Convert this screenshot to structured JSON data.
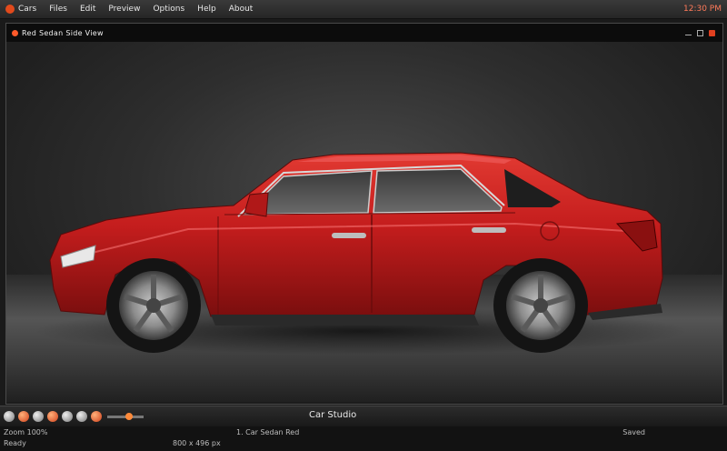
{
  "menubar": {
    "app_label": "Cars",
    "items": [
      "Files",
      "Edit",
      "Preview",
      "Options",
      "Help",
      "About"
    ],
    "right_status": "12:30 PM"
  },
  "viewer": {
    "title": "Red Sedan Side View"
  },
  "toolbar": {
    "center_label": "Car Studio",
    "slider_value": 0.6
  },
  "statusbar": {
    "left_line1": "Zoom 100%",
    "left_line2": "Ready",
    "mid_line1": "1. Car Sedan Red",
    "mid_line2": "800 x 496 px",
    "right": "Saved"
  },
  "colors": {
    "accent": "#e24a1c",
    "car_body": "#c41d1d"
  }
}
